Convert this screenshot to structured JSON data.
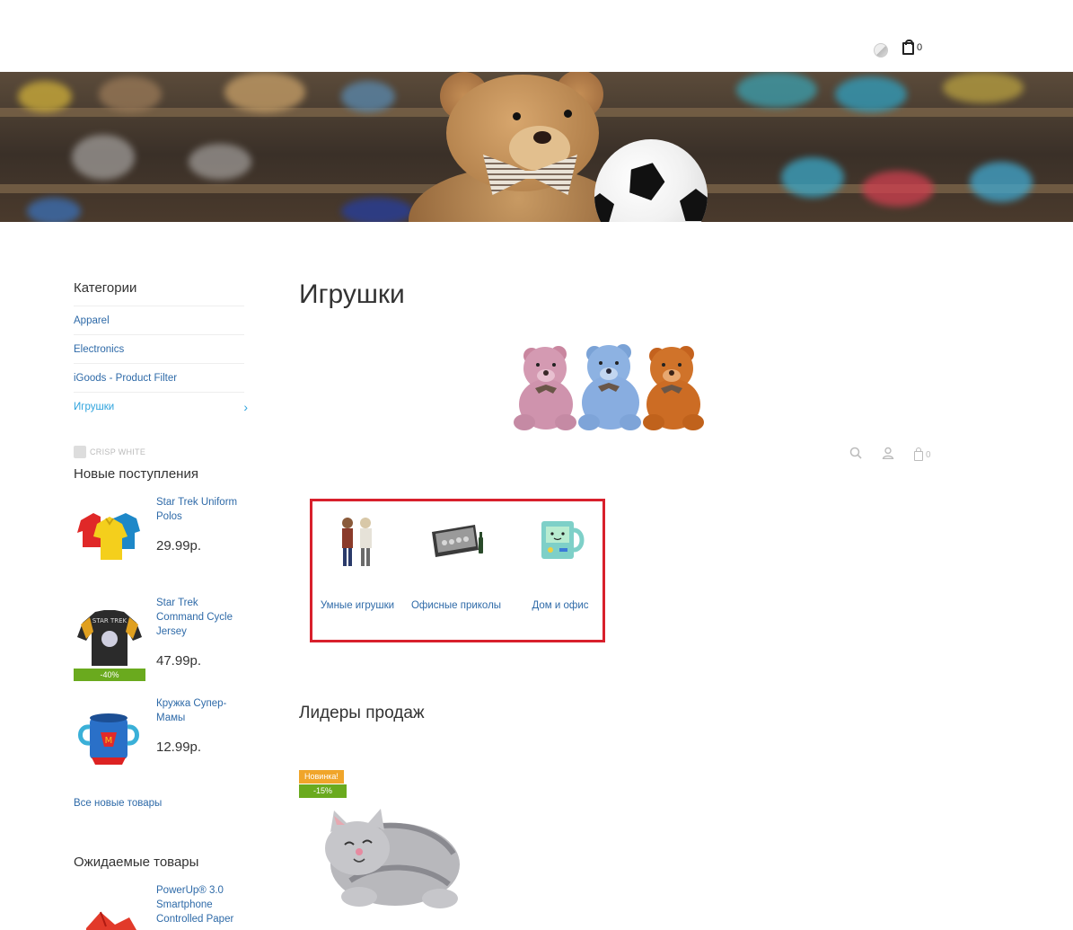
{
  "header": {
    "cart_count": "0"
  },
  "toolbar": {
    "cart_count": "0"
  },
  "sidebar": {
    "categories_title": "Категории",
    "categories": [
      {
        "label": "Apparel"
      },
      {
        "label": "Electronics"
      },
      {
        "label": "iGoods - Product Filter"
      },
      {
        "label": "Игрушки"
      }
    ],
    "crisp_label": "CRISP WHITE",
    "new_arrivals_title": "Новые поступления",
    "new_arrivals": [
      {
        "name": "Star Trek Uniform Polos",
        "price": "29.99р."
      },
      {
        "name": "Star Trek Command Cycle Jersey",
        "price": "47.99р.",
        "badge": "-40%"
      },
      {
        "name": "Кружка Супер-Мамы",
        "price": "12.99р."
      }
    ],
    "all_new_link": "Все новые товары",
    "expected_title": "Ожидаемые товары",
    "expected": [
      {
        "name": "PowerUp® 3.0 Smartphone Controlled Paper"
      }
    ]
  },
  "main": {
    "title": "Игрушки",
    "subcategories": [
      {
        "label": "Умные игрушки"
      },
      {
        "label": "Офисные приколы"
      },
      {
        "label": "Дом и офис"
      }
    ],
    "bestsellers_title": "Лидеры продаж",
    "bestseller_badges": {
      "new": "Новинка!",
      "discount": "-15%"
    }
  }
}
